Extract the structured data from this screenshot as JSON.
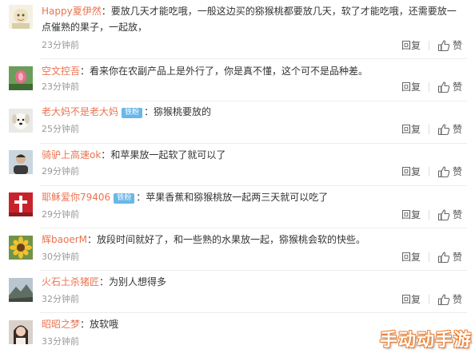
{
  "reply_label": "回复",
  "like_label": "赞",
  "watermark": "手动动手游",
  "colors": {
    "username": "#eb7350",
    "badge": "#69b7e8",
    "time": "#999999",
    "text": "#333333"
  },
  "comments": [
    {
      "user": "Happy夏伊然",
      "badge": "",
      "sep": "：",
      "text": "要放几天才能吃哦，一般这边买的猕猴桃都要放几天，软了才能吃哦，还需要放一点催熟的果子，一起放，",
      "time": "23分钟前",
      "avatar_icon": "cartoon-avatar-icon"
    },
    {
      "user": "空文控吾",
      "badge": "",
      "sep": "：",
      "text": "看来你在农副产品上是外行了，你是真不懂，这个可不是品种差。",
      "time": "23分钟前",
      "avatar_icon": "lotus-avatar-icon"
    },
    {
      "user": "老大妈不是老大妈",
      "badge": "铁粉",
      "sep": "：",
      "text": "猕猴桃要放的",
      "time": "25分钟前",
      "avatar_icon": "dog-avatar-icon"
    },
    {
      "user": "骑驴上高速ok",
      "badge": "",
      "sep": "：",
      "text": "和苹果放一起软了就可以了",
      "time": "29分钟前",
      "avatar_icon": "person-avatar-icon"
    },
    {
      "user": "耶稣爱你79406",
      "badge": "铁粉",
      "sep": "：",
      "text": "苹果香蕉和猕猴桃放一起两三天就可以吃了",
      "time": "29分钟前",
      "avatar_icon": "cross-avatar-icon"
    },
    {
      "user": "辉baoerM",
      "badge": "",
      "sep": "：",
      "text": "放段时间就好了，和一些熟的水果放一起，猕猴桃会软的快些。",
      "time": "30分钟前",
      "avatar_icon": "sunflower-avatar-icon"
    },
    {
      "user": "火石土杀猪匠",
      "badge": "",
      "sep": "：",
      "text": "为别人想得多",
      "time": "32分钟前",
      "avatar_icon": "mountain-avatar-icon"
    },
    {
      "user": "昭昭之梦",
      "badge": "",
      "sep": "：",
      "text": "放软哦",
      "time": "33分钟前",
      "avatar_icon": "girl-avatar-icon"
    }
  ]
}
